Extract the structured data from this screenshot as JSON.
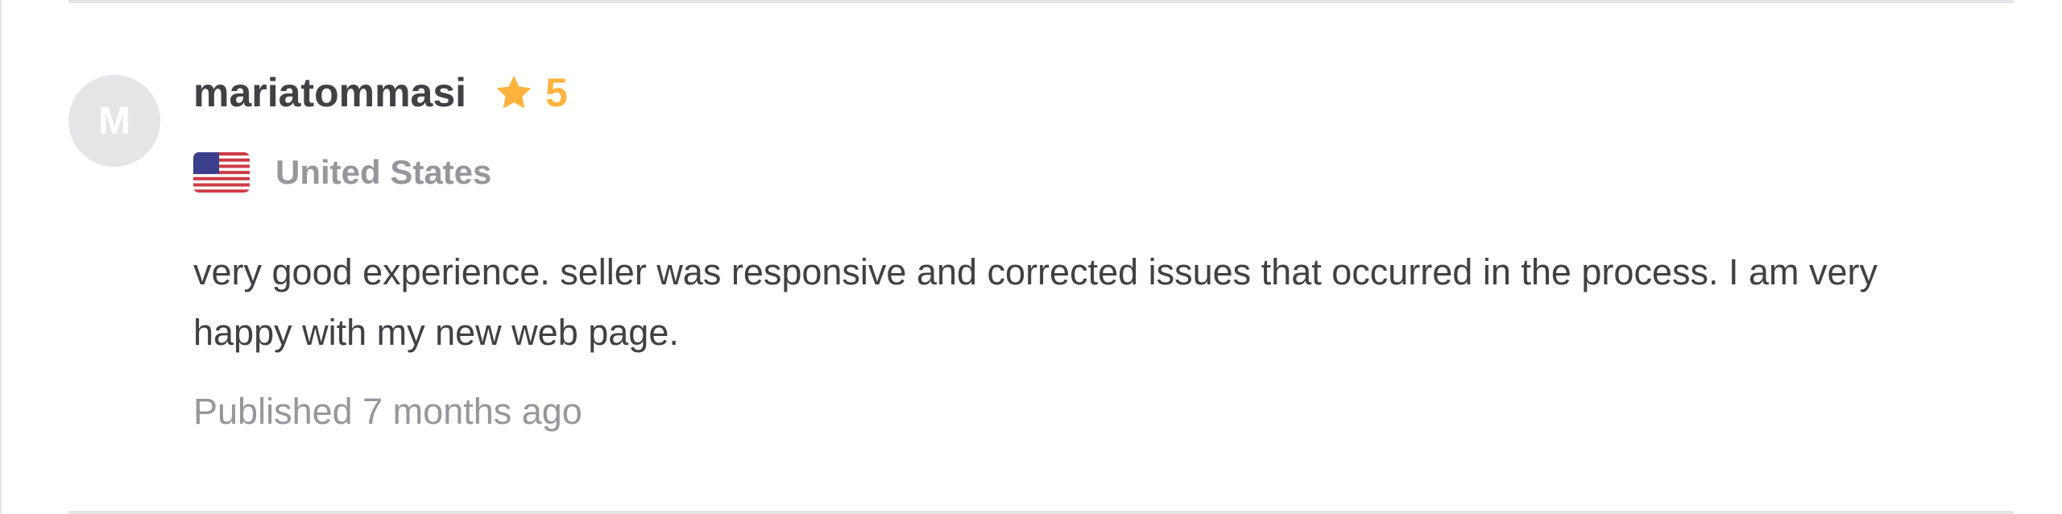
{
  "review": {
    "avatar_initial": "M",
    "username": "mariatommasi",
    "rating": {
      "icon": "star-icon",
      "value": "5",
      "color": "#ffb33e"
    },
    "country": {
      "flag_icon": "us-flag-icon",
      "name": "United States"
    },
    "text": "very good experience. seller was responsive and corrected issues that occurred in the process. I am very happy with my new web page.",
    "published": "Published 7 months ago"
  },
  "colors": {
    "text_primary": "#404145",
    "text_muted": "#95979d",
    "divider": "#e4e5e7",
    "avatar_bg": "#e4e5e7"
  }
}
